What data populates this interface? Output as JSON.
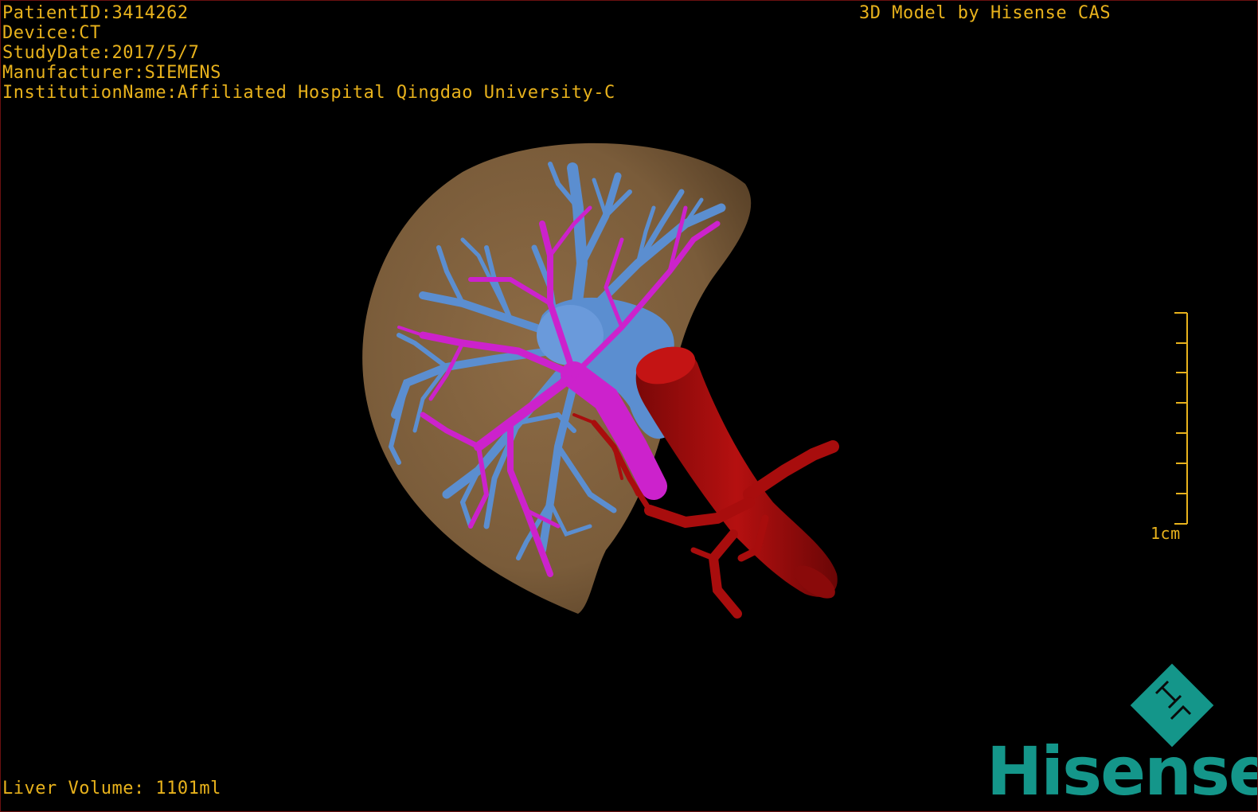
{
  "overlay": {
    "patient_id": "PatientID:3414262",
    "device": "Device:CT",
    "study_date": "StudyDate:2017/5/7",
    "manufacturer": "Manufacturer:SIEMENS",
    "institution": "InstitutionName:Affiliated Hospital Qingdao University-C",
    "model_credit": "3D Model by Hisense CAS",
    "liver_volume": "Liver Volume: 1101ml"
  },
  "scale_bar": {
    "label": "1cm",
    "tick_count": 8
  },
  "brand": {
    "logo_icon": "hisense-diamond-logo-icon",
    "wordmark": "Hisense"
  },
  "colors": {
    "overlay_text": "#e8b21c",
    "liver": "#8a6a45",
    "hepatic_vein": "#5b8ed0",
    "portal_vein": "#cc22cc",
    "artery_ivc": "#a80d0d",
    "brand": "#14968a"
  }
}
